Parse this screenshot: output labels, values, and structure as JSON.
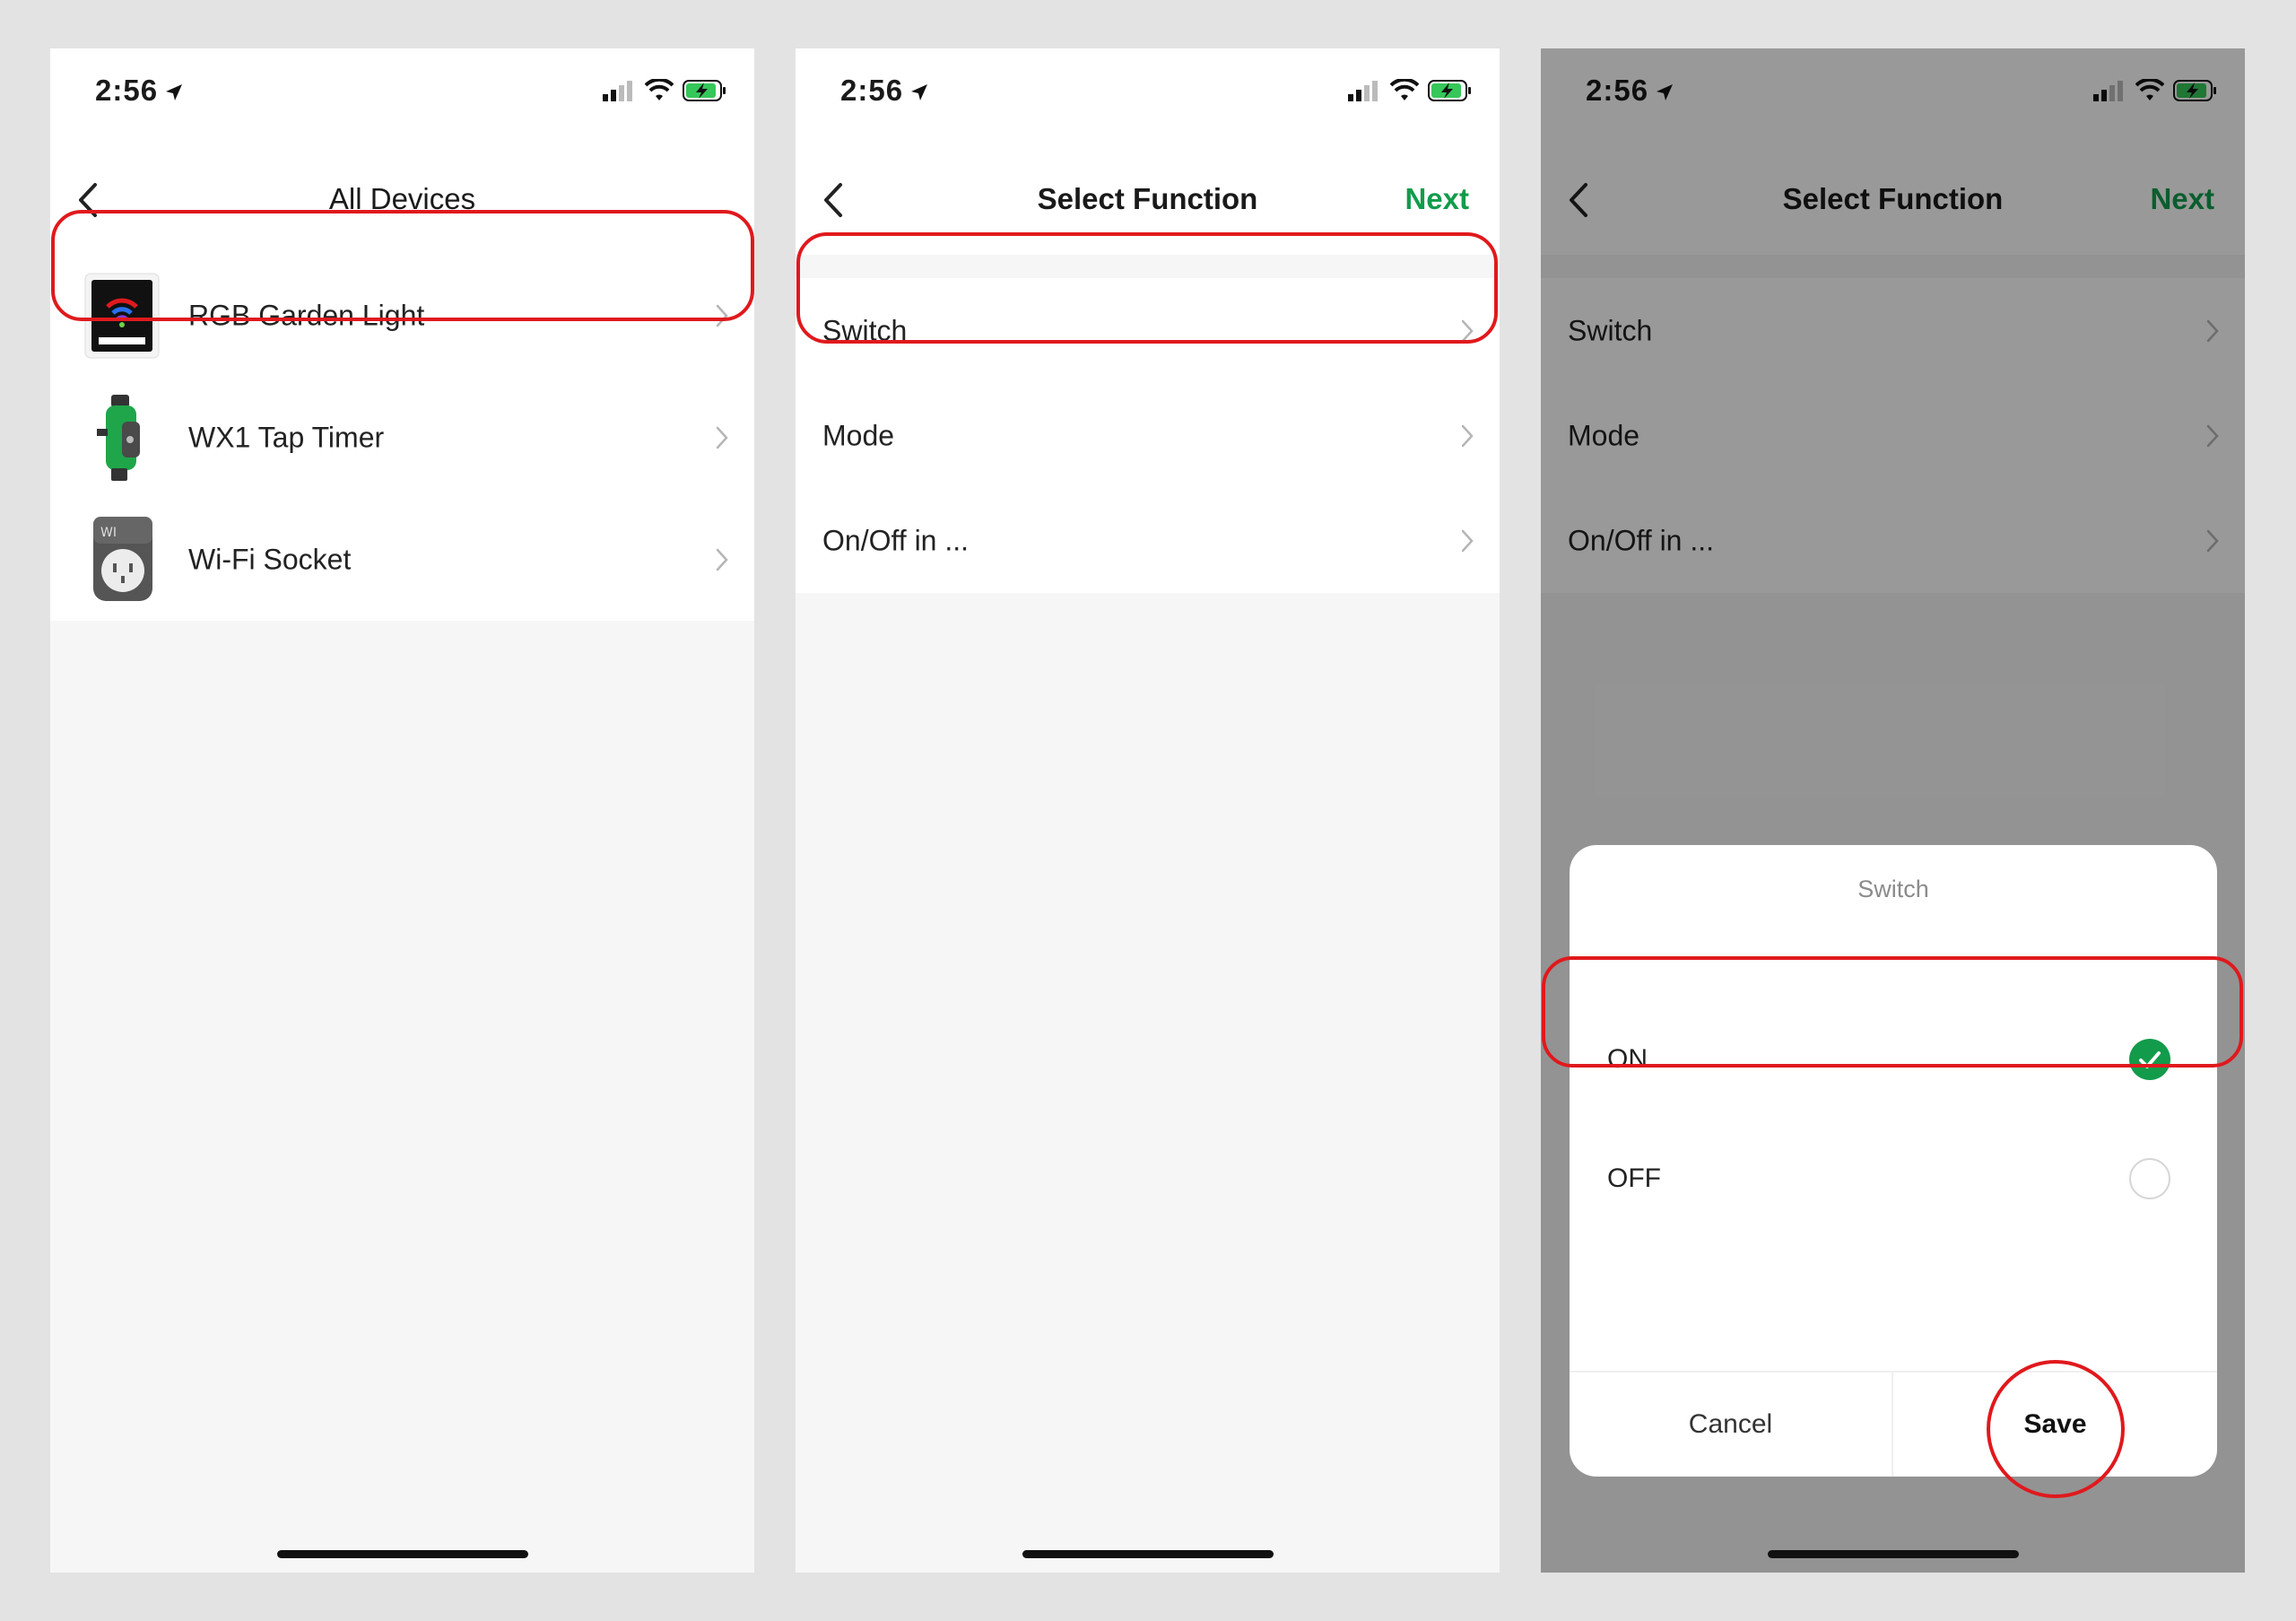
{
  "status_bar": {
    "time": "2:56"
  },
  "screen1": {
    "title": "All Devices",
    "devices": [
      {
        "label": "RGB Garden Light",
        "icon": "rgb-light-device-icon"
      },
      {
        "label": "WX1 Tap Timer",
        "icon": "tap-timer-device-icon"
      },
      {
        "label": "Wi-Fi Socket",
        "icon": "wifi-socket-device-icon"
      }
    ]
  },
  "screen2": {
    "title": "Select Function",
    "next_label": "Next",
    "functions": [
      {
        "label": "Switch"
      },
      {
        "label": "Mode"
      },
      {
        "label": "On/Off in ..."
      }
    ]
  },
  "screen3": {
    "title": "Select Function",
    "next_label": "Next",
    "functions": [
      {
        "label": "Switch"
      },
      {
        "label": "Mode"
      },
      {
        "label": "On/Off in ..."
      }
    ],
    "sheet": {
      "title": "Switch",
      "options": [
        {
          "label": "ON",
          "selected": true
        },
        {
          "label": "OFF",
          "selected": false
        }
      ],
      "cancel_label": "Cancel",
      "save_label": "Save"
    }
  },
  "colors": {
    "accent": "#129b4b",
    "highlight": "#e0191d",
    "background": "#f6f6f6"
  }
}
